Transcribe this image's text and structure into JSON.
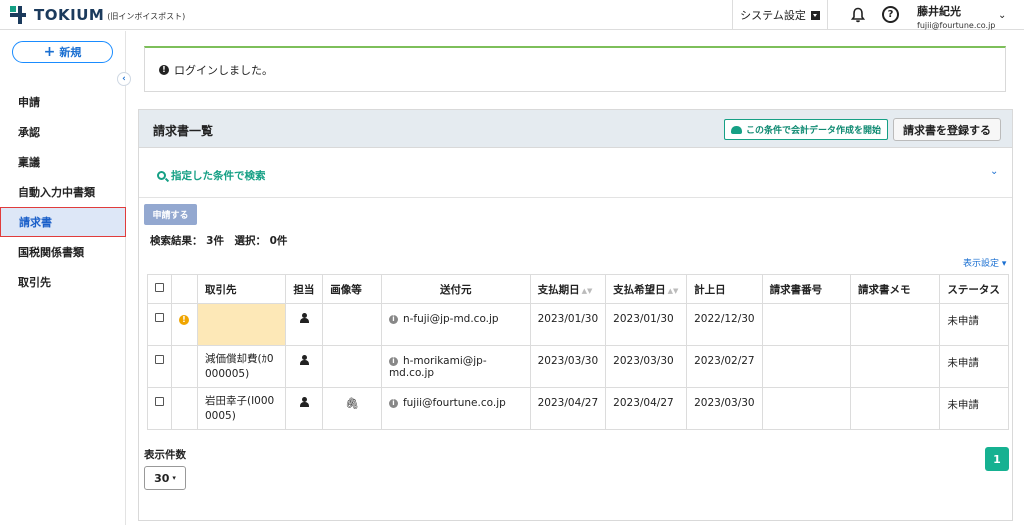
{
  "header": {
    "logo_text": "TOKIUM",
    "logo_sub": "(旧インボイスポスト)",
    "settings_label": "システム設定",
    "help_glyph": "?",
    "user_name": "藤井紀光",
    "user_email": "fujii@fourtune.co.jp",
    "user_chevron": "⌄"
  },
  "sidebar": {
    "new_button": "新規",
    "new_plus": "+",
    "collapse_glyph": "‹",
    "items": [
      {
        "label": "申請"
      },
      {
        "label": "承認"
      },
      {
        "label": "稟議"
      },
      {
        "label": "自動入力中書類"
      },
      {
        "label": "請求書"
      },
      {
        "label": "国税関係書類"
      },
      {
        "label": "取引先"
      }
    ]
  },
  "alert": {
    "message": "ログインしました。",
    "icon_glyph": "!"
  },
  "panel": {
    "title": "請求書一覧",
    "export_button": "この条件で会計データ作成を開始",
    "register_button": "請求書を登録する",
    "search_link": "指定した条件で検索",
    "search_chevron": "⌄",
    "apply_button": "申請する",
    "results_text": "検索結果： 3件　選択： 0件",
    "display_settings": "表示設定 ▾",
    "per_page_label": "表示件数",
    "per_page_value": "30",
    "per_page_caret": "▾",
    "current_page": "1"
  },
  "table": {
    "headers": {
      "client": "取引先",
      "owner": "担当",
      "images": "画像等",
      "sender": "送付元",
      "due_date": "支払期日",
      "desired_date": "支払希望日",
      "posting_date": "計上日",
      "invoice_no": "請求書番号",
      "memo": "請求書メモ",
      "status": "ステータス"
    },
    "sort_glyph": "▲▼",
    "info_glyph": "i",
    "warn_glyph": "!",
    "clip_glyph": "🖇",
    "rows": [
      {
        "client": "",
        "sender": "n-fuji@jp-md.co.jp",
        "due_date": "2023/01/30",
        "desired_date": "2023/01/30",
        "posting_date": "2022/12/30",
        "invoice_no": "",
        "memo": "",
        "status": "未申請"
      },
      {
        "client": "減価償却費(ｶ0000005)",
        "sender": "h-morikami@jp-md.co.jp",
        "due_date": "2023/03/30",
        "desired_date": "2023/03/30",
        "posting_date": "2023/02/27",
        "invoice_no": "",
        "memo": "",
        "status": "未申請"
      },
      {
        "client": "岩田幸子(I0000005)",
        "sender": "fujii@fourtune.co.jp",
        "due_date": "2023/04/27",
        "desired_date": "2023/04/27",
        "posting_date": "2023/03/30",
        "invoice_no": "",
        "memo": "",
        "status": "未申請"
      }
    ]
  },
  "colors": {
    "brand_teal": "#16a085",
    "brand_navy": "#1b3a5c",
    "link_blue": "#1a6fd1",
    "active_nav_bg": "#dde7f7",
    "active_nav_outline": "#e03c3c",
    "warning": "#f0a500",
    "pager": "#16b191"
  }
}
